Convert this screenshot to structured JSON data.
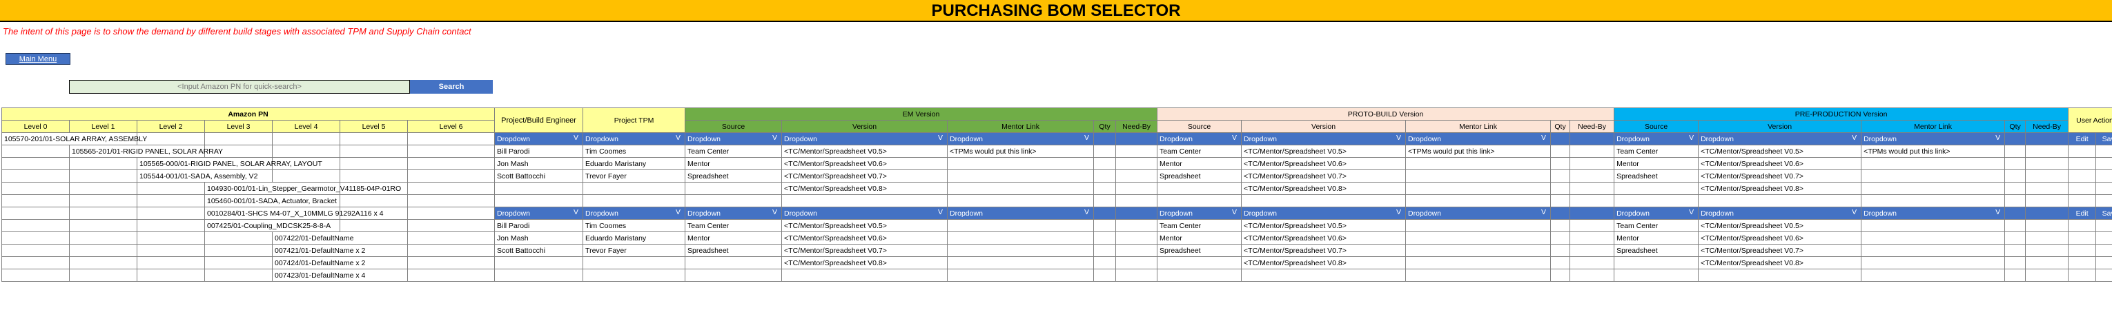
{
  "header": {
    "title": "PURCHASING BOM SELECTOR",
    "intent": "The intent of this page is to show the demand by different build stages with associated TPM and Supply Chain contact"
  },
  "nav": {
    "main_menu": "Main Menu"
  },
  "search": {
    "placeholder": "<Input Amazon PN for quick-search>",
    "button": "Search"
  },
  "table": {
    "groups": {
      "amazon_pn": "Amazon PN",
      "project_engineer": "Project/Build Engineer",
      "project_tpm": "Project TPM",
      "em": "EM Version",
      "proto": "PROTO-BUILD Version",
      "preprod": "PRE-PRODUCTION Version",
      "user_actions": "User Actions"
    },
    "levels": [
      "Level 0",
      "Level 1",
      "Level 2",
      "Level 3",
      "Level 4",
      "Level 5",
      "Level 6"
    ],
    "sub": {
      "source": "Source",
      "version": "Version",
      "mentor": "Mentor Link",
      "qty": "Qty",
      "needby": "Need-By"
    },
    "dropdown_label": "Dropdown",
    "dropdown_arrow": "V",
    "edit": "Edit",
    "save": "Save",
    "rows": [
      {
        "part": "105570-201/01-SOLAR ARRAY, ASSEMBLY",
        "level": 0,
        "kind": "dd"
      },
      {
        "part": "105565-201/01-RIGID PANEL, SOLAR ARRAY",
        "level": 1,
        "eng": "Bill Parodi",
        "tpm": "Tim Coomes",
        "src": "Team Center",
        "ver": "<TC/Mentor/Spreadsheet V0.5>",
        "mentor": "<TPMs would put this link>"
      },
      {
        "part": "105565-000/01-RIGID PANEL, SOLAR ARRAY, LAYOUT",
        "level": 2,
        "eng": "Jon Mash",
        "tpm": "Eduardo Maristany",
        "src": "Mentor",
        "ver": "<TC/Mentor/Spreadsheet V0.6>",
        "mentor": ""
      },
      {
        "part": "105544-001/01-SADA, Assembly, V2",
        "level": 2,
        "eng": "Scott Battocchi",
        "tpm": "Trevor Fayer",
        "src": "Spreadsheet",
        "ver": "<TC/Mentor/Spreadsheet V0.7>",
        "mentor": ""
      },
      {
        "part": "104930-001/01-Lin_Stepper_Gearmotor_V41185-04P-01RO",
        "level": 3,
        "eng": "",
        "tpm": "",
        "src": "",
        "ver": "<TC/Mentor/Spreadsheet V0.8>",
        "mentor": ""
      },
      {
        "part": "105460-001/01-SADA, Actuator, Bracket",
        "level": 3,
        "eng": "",
        "tpm": "",
        "src": "",
        "ver": "",
        "mentor": ""
      },
      {
        "part": "0010284/01-SHCS M4-07_X_10MMLG 91292A116 x 4",
        "level": 3,
        "kind": "dd"
      },
      {
        "part": "007425/01-Coupling_MDCSK25-8-8-A",
        "level": 3,
        "eng": "Bill Parodi",
        "tpm": "Tim Coomes",
        "src": "Team Center",
        "ver": "<TC/Mentor/Spreadsheet V0.5>",
        "mentor": ""
      },
      {
        "part": "007422/01-DefaultName",
        "level": 4,
        "eng": "Jon Mash",
        "tpm": "Eduardo Maristany",
        "src": "Mentor",
        "ver": "<TC/Mentor/Spreadsheet V0.6>",
        "mentor": ""
      },
      {
        "part": "007421/01-DefaultName x 2",
        "level": 4,
        "eng": "Scott Battocchi",
        "tpm": "Trevor Fayer",
        "src": "Spreadsheet",
        "ver": "<TC/Mentor/Spreadsheet V0.7>",
        "mentor": ""
      },
      {
        "part": "007424/01-DefaultName x 2",
        "level": 4,
        "eng": "",
        "tpm": "",
        "src": "",
        "ver": "<TC/Mentor/Spreadsheet V0.8>",
        "mentor": ""
      },
      {
        "part": "007423/01-DefaultName x 4",
        "level": 4,
        "eng": "",
        "tpm": "",
        "src": "",
        "ver": "",
        "mentor": ""
      }
    ]
  },
  "colors": {
    "title_bg": "#ffc000",
    "em_green": "#70ad47",
    "proto_peach": "#fce4d6",
    "preprod_blue": "#00b0f0",
    "dropdown_blue": "#4472c4",
    "header_yellow": "#ffff99"
  }
}
